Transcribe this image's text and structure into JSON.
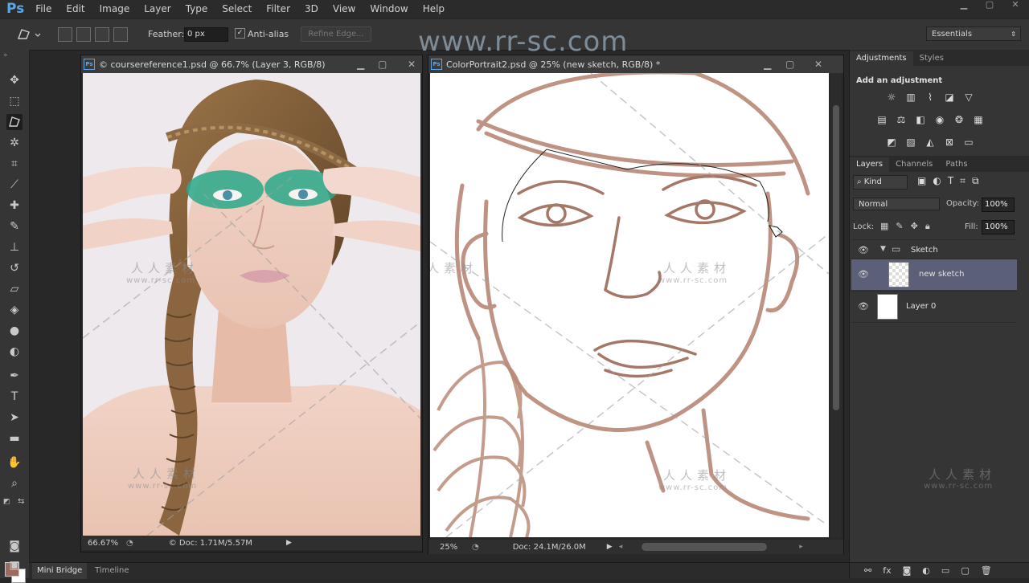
{
  "app": {
    "logo": "Ps",
    "menu": [
      "File",
      "Edit",
      "Image",
      "Layer",
      "Type",
      "Select",
      "Filter",
      "3D",
      "View",
      "Window",
      "Help"
    ]
  },
  "watermark": {
    "url": "www.rr-sc.com",
    "cn": "人人素材",
    "small_url": "www.rr-sc.com"
  },
  "options_bar": {
    "feather_label": "Feather:",
    "feather_value": "0 px",
    "antialias_label": "Anti-alias",
    "antialias_checked": true,
    "refine_edge_label": "Refine Edge...",
    "workspace": "Essentials"
  },
  "documents": [
    {
      "title": "© coursereference1.psd @ 66.7% (Layer 3, RGB/8)",
      "zoom": "66.67%",
      "doc_size": "© Doc: 1.71M/5.57M"
    },
    {
      "title": "ColorPortrait2.psd @ 25% (new sketch, RGB/8) *",
      "zoom": "25%",
      "doc_size": "Doc: 24.1M/26.0M"
    }
  ],
  "adjustments_panel": {
    "tabs": [
      "Adjustments",
      "Styles"
    ],
    "heading": "Add an adjustment"
  },
  "layers_panel": {
    "tabs": [
      "Layers",
      "Channels",
      "Paths"
    ],
    "filter_kind": "Kind",
    "blend_mode": "Normal",
    "opacity_label": "Opacity:",
    "opacity_value": "100%",
    "lock_label": "Lock:",
    "fill_label": "Fill:",
    "fill_value": "100%",
    "layers": [
      {
        "name": "Sketch",
        "type": "group"
      },
      {
        "name": "new sketch",
        "type": "layer",
        "selected": true
      },
      {
        "name": "Layer 0",
        "type": "layer"
      }
    ]
  },
  "bottom_tabs": [
    "Mini Bridge",
    "Timeline"
  ],
  "colors": {
    "foreground": "#9a6b5e",
    "background": "#ffffff",
    "accent": "#5aa6e6"
  }
}
